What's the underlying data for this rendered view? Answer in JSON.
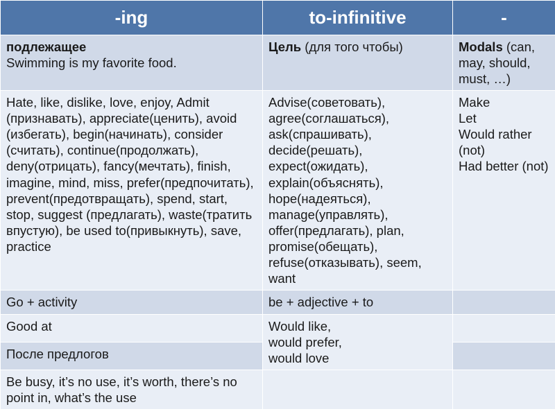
{
  "header": {
    "col1": "-ing",
    "col2": "to-infinitive",
    "col3": "-"
  },
  "rows": [
    {
      "shade": "dark",
      "ing": {
        "bold": "подлежащее",
        "rest": "Swimming is my favorite food."
      },
      "inf": {
        "bold": "Цель ",
        "rest": "(для того чтобы)"
      },
      "bare": {
        "bold": "Modals ",
        "rest": "(can, may, should, must, …)"
      }
    },
    {
      "shade": "light",
      "ing": {
        "plain": "Hate, like, dislike, love, enjoy, Admit (признавать), appreciate(ценить), avoid (избегать), begin(начинать), consider (считать), continue(продолжать), deny(отрицать), fancy(мечтать), finish, imagine, mind, miss, prefer(предпочитать), prevent(предотвращать), spend, start, stop, suggest (предлагать), waste(тратить впустую), be used to(привыкнуть), save, practice"
      },
      "inf": {
        "plain": "Advise(советовать), agree(соглашаться), ask(спрашивать), decide(решать), expect(ожидать), explain(объяснять), hope(надеяться), manage(управлять), offer(предлагать), plan, promise(обещать), refuse(отказывать), seem, want"
      },
      "bare": {
        "lines": [
          "Make",
          "Let",
          "Would rather (not)",
          "Had better (not)"
        ]
      }
    },
    {
      "shade": "dark",
      "ing": {
        "plain": "Go + activity"
      },
      "inf": {
        "plain": "be + adjective + to"
      },
      "bare": {
        "plain": ""
      }
    },
    {
      "shade": "light",
      "ing": {
        "plain": "Good at"
      },
      "inf": {
        "lines": [
          "Would like,",
          "would prefer,",
          "would love"
        ],
        "rowspan": 2
      },
      "bare": {
        "plain": ""
      }
    },
    {
      "shade": "dark",
      "ing": {
        "plain": "После предлогов"
      },
      "bare": {
        "plain": ""
      }
    },
    {
      "shade": "light",
      "ing": {
        "plain": "Be busy, it’s no use, it’s worth, there’s no point in, what’s the use"
      },
      "inf": {
        "plain": ""
      },
      "bare": {
        "plain": ""
      }
    }
  ]
}
